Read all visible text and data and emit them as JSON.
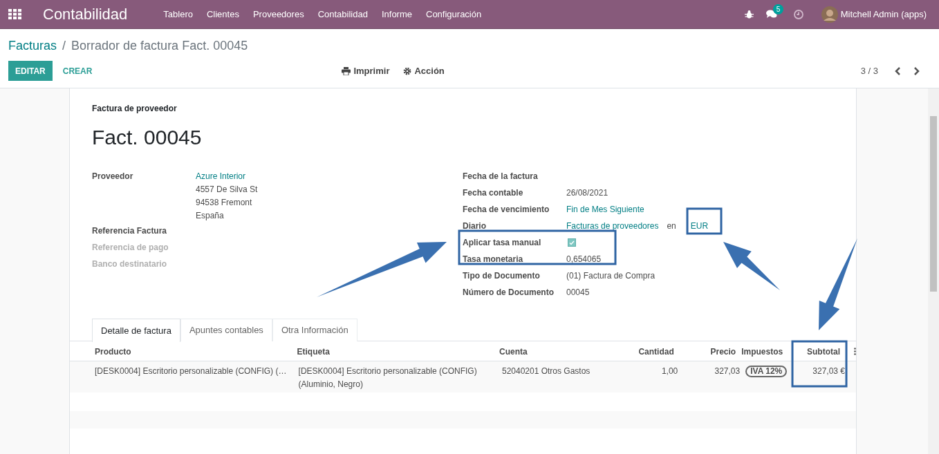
{
  "navbar": {
    "app_name": "Contabilidad",
    "menu": [
      "Tablero",
      "Clientes",
      "Proveedores",
      "Contabilidad",
      "Informe",
      "Configuración"
    ],
    "messages_badge": "5",
    "user": "Mitchell Admin (apps)"
  },
  "breadcrumb": {
    "parent": "Facturas",
    "separator": "/",
    "current": "Borrador de factura Fact. 00045"
  },
  "buttons": {
    "edit": "EDITAR",
    "create": "CREAR",
    "print": "Imprimir",
    "action": "Acción"
  },
  "pager": "3 / 3",
  "form": {
    "subtitle": "Factura de proveedor",
    "title": "Fact. 00045",
    "left_fields": [
      {
        "label": "Proveedor",
        "muted": false,
        "kind": "address",
        "lines": [
          "Azure Interior",
          "4557 De Silva St",
          "94538 Fremont",
          "España"
        ]
      },
      {
        "label": "Referencia Factura",
        "muted": false,
        "kind": "empty"
      },
      {
        "label": "Referencia de pago",
        "muted": true,
        "kind": "empty"
      },
      {
        "label": "Banco destinatario",
        "muted": true,
        "kind": "empty"
      }
    ],
    "right_fields": [
      {
        "label": "Fecha de la factura",
        "kind": "empty"
      },
      {
        "label": "Fecha contable",
        "kind": "text",
        "value": "26/08/2021"
      },
      {
        "label": "Fecha de vencimiento",
        "kind": "link",
        "value": "Fin de Mes Siguiente"
      },
      {
        "label": "Diario",
        "kind": "journal",
        "value": "Facturas de proveedores",
        "joiner": "en",
        "currency": "EUR"
      },
      {
        "label": "Aplicar tasa manual",
        "kind": "checkbox",
        "checked": true
      },
      {
        "label": "Tasa monetaria",
        "kind": "text",
        "value": "0,654065"
      },
      {
        "label": "Tipo de Documento",
        "kind": "text",
        "value": "(01) Factura de Compra"
      },
      {
        "label": "Número de Documento",
        "kind": "text",
        "value": "00045"
      }
    ],
    "tabs": [
      {
        "label": "Detalle de factura",
        "selected": true
      },
      {
        "label": "Apuntes contables",
        "selected": false
      },
      {
        "label": "Otra Información",
        "selected": false
      }
    ],
    "table": {
      "columns": [
        "Producto",
        "Etiqueta",
        "Cuenta",
        "Cantidad",
        "Precio",
        "Impuestos",
        "Subtotal"
      ],
      "rows": [
        {
          "producto": "[DESK0004] Escritorio personalizable (CONFIG) (…",
          "etiqueta": "[DESK0004] Escritorio personalizable (CONFIG) (Aluminio, Negro)",
          "cuenta": "52040201 Otros Gastos",
          "cantidad": "1,00",
          "precio": "327,03",
          "impuestos": "IVA 12%",
          "subtotal": "327,03 €"
        }
      ]
    }
  }
}
